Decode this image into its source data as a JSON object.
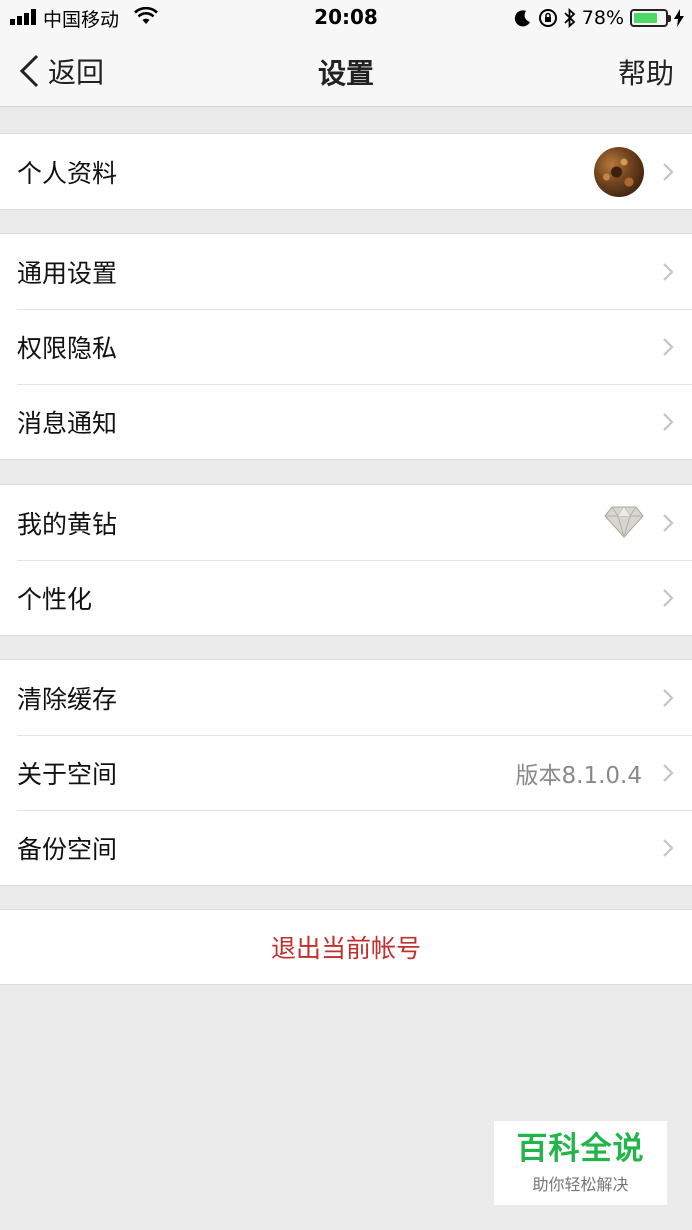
{
  "status_bar": {
    "carrier": "中国移动",
    "time": "20:08",
    "battery": "78%",
    "battery_level": 0.78
  },
  "nav": {
    "back_label": "返回",
    "title": "设置",
    "help_label": "帮助"
  },
  "groups": [
    {
      "items": [
        {
          "label": "个人资料",
          "accessory": "avatar"
        }
      ]
    },
    {
      "items": [
        {
          "label": "通用设置"
        },
        {
          "label": "权限隐私"
        },
        {
          "label": "消息通知"
        }
      ]
    },
    {
      "items": [
        {
          "label": "我的黄钻",
          "accessory": "diamond-icon"
        },
        {
          "label": "个性化"
        }
      ]
    },
    {
      "items": [
        {
          "label": "清除缓存"
        },
        {
          "label": "关于空间",
          "value": "版本8.1.0.4"
        },
        {
          "label": "备份空间"
        }
      ]
    }
  ],
  "logout": {
    "label": "退出当前帐号",
    "color": "#c0302c"
  },
  "watermark": {
    "title": "百科全说",
    "subtitle": "助你轻松解决"
  },
  "colors": {
    "background": "#ebebeb",
    "accent_green": "#22b54a",
    "danger_red": "#c0302c"
  }
}
